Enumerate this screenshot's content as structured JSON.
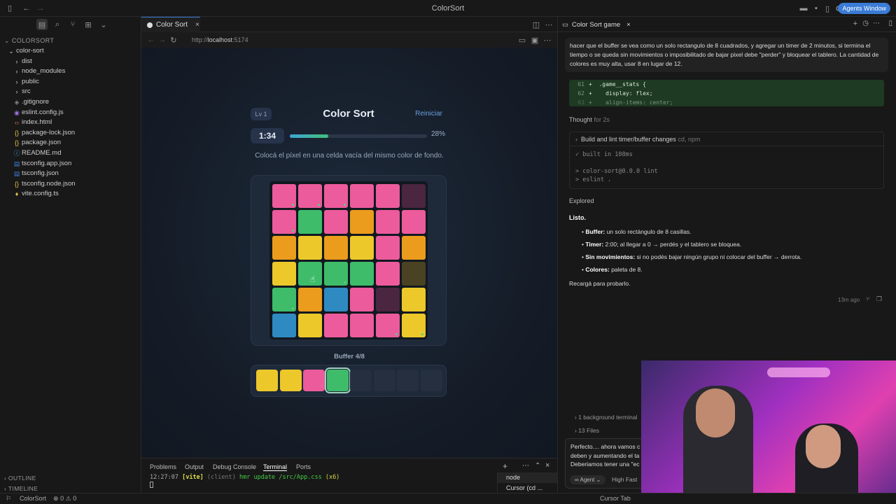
{
  "window": {
    "title": "ColorSort",
    "agents_button": "Agents Window"
  },
  "explorer": {
    "root": "COLORSORT",
    "items": [
      {
        "label": "color-sort",
        "icon": "chevron-down",
        "indent": 0,
        "color": "#cccccc"
      },
      {
        "label": "dist",
        "icon": "chevron-right",
        "indent": 1,
        "color": "#cccccc"
      },
      {
        "label": "node_modules",
        "icon": "chevron-right",
        "indent": 1,
        "color": "#cccccc"
      },
      {
        "label": "public",
        "icon": "chevron-right",
        "indent": 1,
        "color": "#cccccc"
      },
      {
        "label": "src",
        "icon": "chevron-right",
        "indent": 1,
        "color": "#cccccc"
      },
      {
        "label": ".gitignore",
        "icon": "gitignore",
        "indent": 1,
        "color": "#888888"
      },
      {
        "label": "eslint.config.js",
        "icon": "eslint",
        "indent": 1,
        "color": "#a070e0"
      },
      {
        "label": "index.html",
        "icon": "html",
        "indent": 1,
        "color": "#e07040"
      },
      {
        "label": "package-lock.json",
        "icon": "json",
        "indent": 1,
        "color": "#e0c040"
      },
      {
        "label": "package.json",
        "icon": "json",
        "indent": 1,
        "color": "#e0c040"
      },
      {
        "label": "README.md",
        "icon": "info",
        "indent": 1,
        "color": "#40a0e0"
      },
      {
        "label": "tsconfig.app.json",
        "icon": "tsconfig",
        "indent": 1,
        "color": "#3a7bd5"
      },
      {
        "label": "tsconfig.json",
        "icon": "tsconfig",
        "indent": 1,
        "color": "#3a7bd5"
      },
      {
        "label": "tsconfig.node.json",
        "icon": "json",
        "indent": 1,
        "color": "#e0c040"
      },
      {
        "label": "vite.config.ts",
        "icon": "vite",
        "indent": 1,
        "color": "#e0c040"
      }
    ],
    "outline": "OUTLINE",
    "timeline": "TIMELINE"
  },
  "editor": {
    "tab_label": "Color Sort",
    "url": "http://localhost:5174",
    "url_host": "localhost"
  },
  "game": {
    "level": "Lv 1",
    "title": "Color Sort",
    "restart": "Reiniciar",
    "timer": "1:34",
    "progress": 0.28,
    "progress_text": "28%",
    "instruction": "Colocá el píxel en una celda vacía del mismo color de fondo.",
    "colors": {
      "P": "#ec5b9c",
      "G": "#3fbc6a",
      "O": "#eb9c1c",
      "Y": "#ecc82a",
      "B": "#2f8ac2",
      "Dm": "#4a2640",
      "Do": "#4a4222",
      "E": "#2a3344"
    },
    "board": [
      [
        "P",
        "P",
        "P",
        "P",
        "P",
        "Dm"
      ],
      [
        "P",
        "G",
        "P",
        "O",
        "P",
        "P"
      ],
      [
        "O",
        "Y",
        "O",
        "Y",
        "P",
        "O"
      ],
      [
        "Y",
        "G",
        "G",
        "G",
        "P",
        "Do"
      ],
      [
        "G",
        "O",
        "B",
        "P",
        "Dm",
        "Y"
      ],
      [
        "B",
        "Y",
        "P",
        "P",
        "P",
        "Y"
      ]
    ],
    "dots": [
      [
        0,
        0
      ],
      [
        0,
        1
      ],
      [
        0,
        2
      ],
      [
        1,
        0
      ],
      [
        3,
        2
      ],
      [
        4,
        0
      ],
      [
        5,
        4
      ],
      [
        5,
        5
      ]
    ],
    "buffer_label": "Buffer 4/8",
    "buffer": [
      "Y",
      "Y",
      "P",
      "G",
      "",
      "",
      "",
      ""
    ],
    "buffer_selected": 3
  },
  "panel": {
    "tabs": [
      "Problems",
      "Output",
      "Debug Console",
      "Terminal",
      "Ports"
    ],
    "active_tab": "Terminal",
    "terminal_line": {
      "time": "12:27:07",
      "tag": "[vite]",
      "client": "(client)",
      "msg": "hmr update /src/App.css",
      "count": "(x6)"
    },
    "terminals": [
      "node",
      "Cursor (cd ..."
    ]
  },
  "chat": {
    "tab": "Color Sort game",
    "user_message": "hacer que el buffer se vea como un solo rectangulo de 8 cuadrados, y agregar un timer de 2 minutos, si termina el tiempo o se queda sin movimientos o imposibilitado de bajar pixel debe \"perder\" y bloquear el tablero. La cantidad de colores es muy alta, usar 8 en lugar de 12.",
    "code": [
      {
        "n": "61",
        "text": "+  .game__stats {"
      },
      {
        "n": "62",
        "text": "+    display: flex;"
      },
      {
        "n": "63",
        "text": "+    align-items: center;"
      }
    ],
    "thought": "Thought",
    "thought_time": "for 2s",
    "build_title": "Build and lint timer/buffer changes",
    "build_meta": "cd, npm",
    "build_lines": [
      "✓ built in 108ms",
      "",
      "> color-sort@0.0.0 lint",
      "> eslint ."
    ],
    "explored": "Explored",
    "listo": "Listo.",
    "bullets": [
      {
        "b": "Buffer:",
        "t": " un solo rectángulo de 8 casillas."
      },
      {
        "b": "Timer:",
        "t": " 2:00; al llegar a 0 → perdés y el tablero se bloquea."
      },
      {
        "b": "Sin movimientos:",
        "t": " si no podés bajar ningún grupo ni colocar del buffer → derrota."
      },
      {
        "b": "Colores:",
        "t": " paleta de 8."
      }
    ],
    "reload": "Recargá para probarlo.",
    "ago": "13m ago",
    "bg_terminal": "1 background terminal",
    "files": "13 Files",
    "input_lines": [
      "Perfecto.... ahora vamos c",
      "deben y aumentando el ta",
      "Deberiamos tener una \"ec"
    ],
    "agent_chip": "Agent",
    "model": "High Fast"
  },
  "status": {
    "project": "ColorSort",
    "errors": "0",
    "warnings": "0",
    "cursor_tab": "Cursor Tab"
  }
}
